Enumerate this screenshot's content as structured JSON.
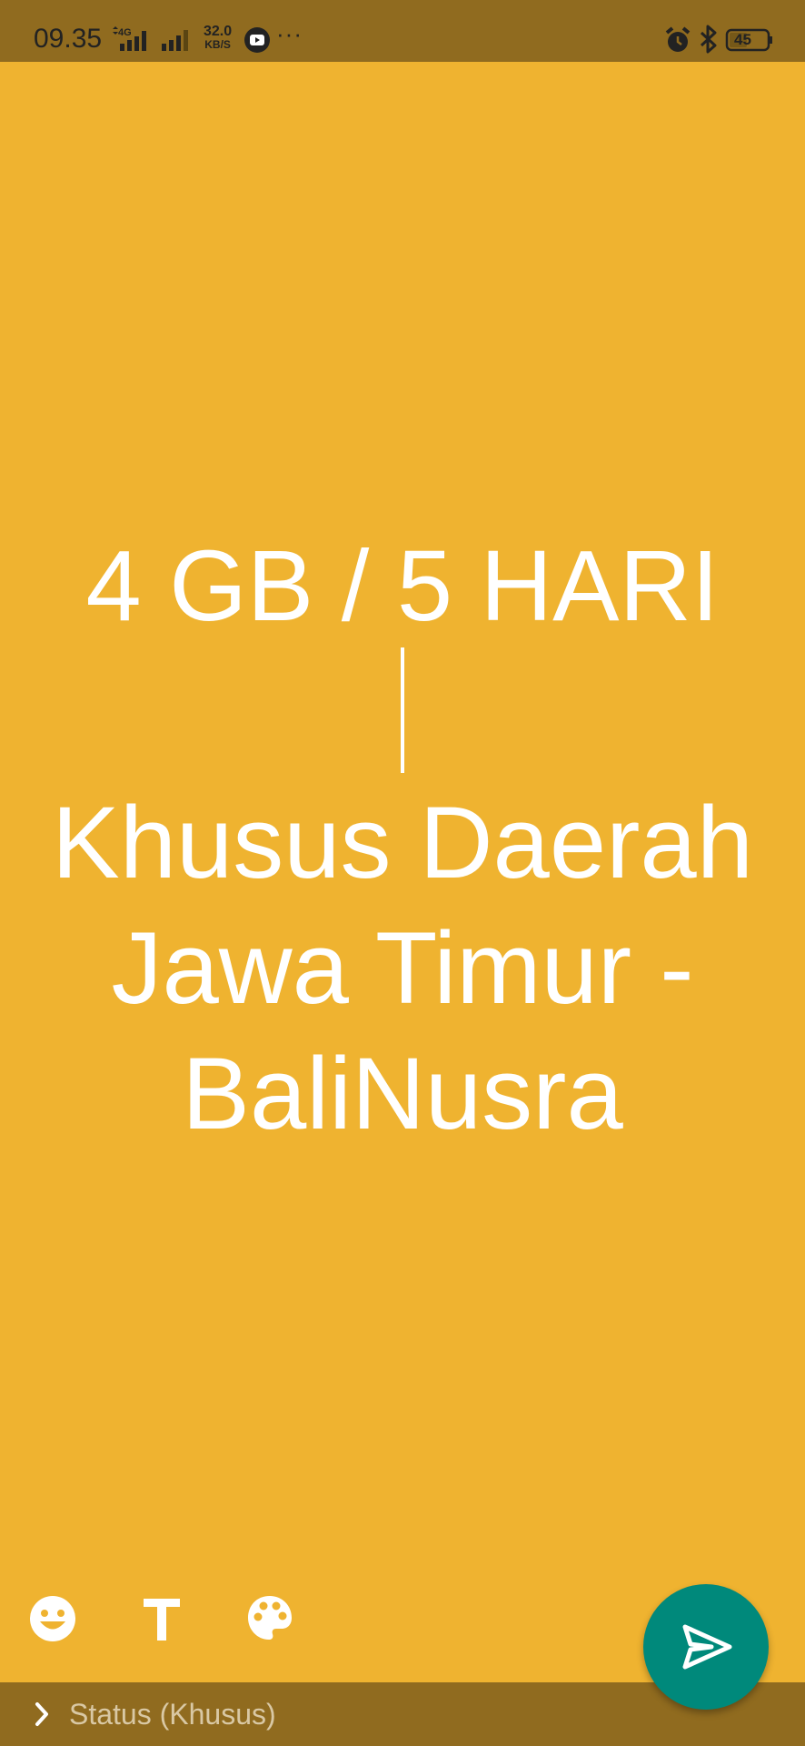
{
  "status_bar": {
    "time": "09.35",
    "net_type": "4G",
    "speed_value": "32.0",
    "speed_unit": "KB/S",
    "more": "···",
    "battery": "45",
    "icons": [
      "signal-4g-icon",
      "signal-icon",
      "youtube-icon",
      "alarm-icon",
      "bluetooth-icon",
      "battery-icon"
    ]
  },
  "status_text": {
    "line1": "4 GB / 5 HARI",
    "line2": "Khusus Daerah",
    "line3": "Jawa Timur -",
    "line4": "BaliNusra"
  },
  "toolbar": {
    "icons": [
      "emoji-icon",
      "text-style-icon",
      "palette-icon",
      "send-icon"
    ]
  },
  "bottom_bar": {
    "audience_label": "Status (Khusus)"
  },
  "colors": {
    "background": "#EFB330",
    "bars": "#906B1F",
    "fab": "#00897B",
    "text": "#FFFFFF"
  }
}
